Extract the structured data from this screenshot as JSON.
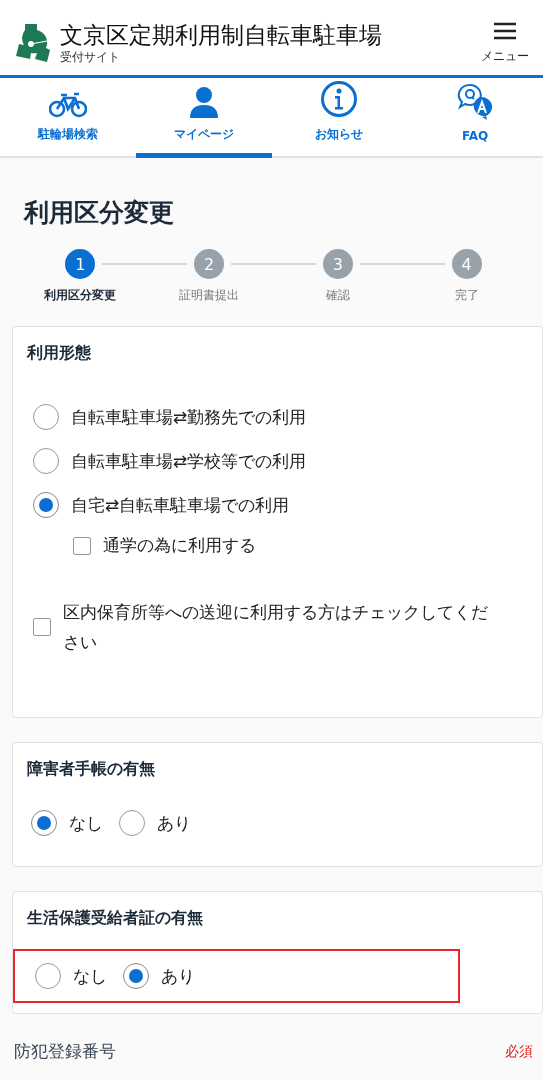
{
  "header": {
    "title": "文京区定期利用制自転車駐車場",
    "subtitle": "受付サイト",
    "menu_label": "メニュー"
  },
  "nav": [
    {
      "kind": "bike",
      "label": "駐輪場検索",
      "selected": false
    },
    {
      "kind": "person",
      "label": "マイページ",
      "selected": true
    },
    {
      "kind": "info",
      "label": "お知らせ",
      "selected": false
    },
    {
      "kind": "faq",
      "label": "FAQ",
      "selected": false
    }
  ],
  "page_title": "利用区分変更",
  "steps": [
    {
      "number": "1",
      "label": "利用区分変更",
      "selected": true
    },
    {
      "number": "2",
      "label": "証明書提出",
      "selected": false
    },
    {
      "number": "3",
      "label": "確認",
      "selected": false
    },
    {
      "number": "4",
      "label": "完了",
      "selected": false
    }
  ],
  "sections": [
    {
      "title": "利用形態",
      "kind": "list",
      "highlighted": false,
      "options": [
        {
          "kind": "radio",
          "label": "自転車駐車場⇄勤務先での利用",
          "selected": false
        },
        {
          "kind": "radio",
          "label": "自転車駐車場⇄学校等での利用",
          "selected": false
        },
        {
          "kind": "radio",
          "label": "自宅⇄自転車駐車場での利用",
          "selected": true,
          "children": [
            {
              "kind": "checkbox",
              "label": "通学の為に利用する",
              "checked": false
            }
          ]
        },
        {
          "kind": "checkbox",
          "label": "区内保育所等への送迎に利用する方はチェックしてください",
          "checked": false
        }
      ]
    },
    {
      "title": "障害者手帳の有無",
      "kind": "row",
      "highlighted": false,
      "options": [
        {
          "kind": "radio",
          "label": "なし",
          "selected": true
        },
        {
          "kind": "radio",
          "label": "あり",
          "selected": false
        }
      ]
    },
    {
      "title": "生活保護受給者証の有無",
      "kind": "row",
      "highlighted": true,
      "options": [
        {
          "kind": "radio",
          "label": "なし",
          "selected": false
        },
        {
          "kind": "radio",
          "label": "あり",
          "selected": true
        }
      ]
    }
  ],
  "field": {
    "label": "防犯登録番号",
    "required_label": "必須"
  }
}
